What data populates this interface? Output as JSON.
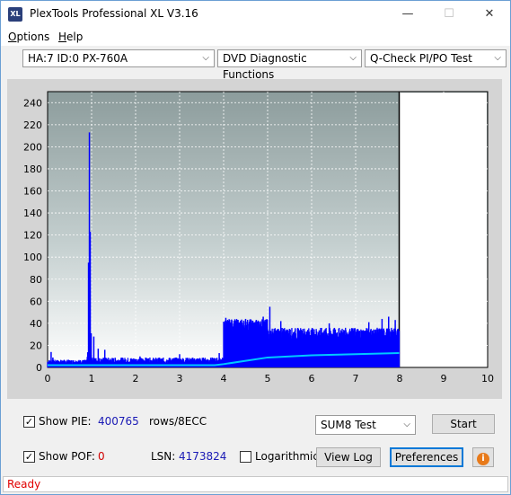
{
  "window": {
    "title": "PlexTools Professional XL V3.16",
    "icon_text": "XL",
    "minimize_glyph": "—",
    "maximize_glyph": "☐",
    "close_glyph": "✕"
  },
  "menu": {
    "items": [
      {
        "label": "Options",
        "underline": "O",
        "rest": "ptions"
      },
      {
        "label": "Help",
        "underline": "H",
        "rest": "elp"
      }
    ]
  },
  "toolbar": {
    "drive": "HA:7 ID:0  PX-760A",
    "function": "DVD Diagnostic Functions",
    "test": "Q-Check PI/PO Test"
  },
  "chart_data": {
    "type": "bar",
    "x_ticks": [
      "0",
      "1",
      "2",
      "3",
      "4",
      "5",
      "6",
      "7",
      "8",
      "9",
      "10"
    ],
    "y_ticks": [
      "0",
      "20",
      "40",
      "60",
      "80",
      "100",
      "120",
      "140",
      "160",
      "180",
      "200",
      "220",
      "240"
    ],
    "xlim": [
      0,
      10
    ],
    "ylim": [
      0,
      250
    ],
    "grid": true,
    "end_marker_x": 7.99,
    "pie_series": {
      "color": "#0000ff",
      "segments": [
        {
          "x_start": 0.0,
          "x_end": 0.9,
          "base": 3,
          "noise": 4,
          "spikes": [
            [
              0.08,
              14
            ],
            [
              0.12,
              9
            ]
          ]
        },
        {
          "x_start": 0.9,
          "x_end": 1.0,
          "base": 6,
          "noise": 8,
          "spikes": [
            [
              0.93,
              95
            ],
            [
              0.95,
              213
            ],
            [
              0.97,
              123
            ],
            [
              0.99,
              31
            ]
          ]
        },
        {
          "x_start": 1.0,
          "x_end": 4.0,
          "base": 3,
          "noise": 6,
          "spikes": [
            [
              1.05,
              28
            ],
            [
              1.15,
              17
            ],
            [
              1.3,
              16
            ],
            [
              2.1,
              10
            ],
            [
              3.0,
              12
            ],
            [
              3.9,
              13
            ]
          ]
        },
        {
          "x_start": 4.0,
          "x_end": 5.0,
          "base": 30,
          "noise": 14,
          "spikes": [
            [
              4.05,
              45
            ],
            [
              4.5,
              44
            ],
            [
              4.9,
              46
            ],
            [
              5.05,
              55
            ]
          ]
        },
        {
          "x_start": 5.0,
          "x_end": 7.99,
          "base": 24,
          "noise": 12,
          "spikes": [
            [
              5.3,
              42
            ],
            [
              6.4,
              40
            ],
            [
              7.3,
              41
            ],
            [
              7.6,
              44
            ],
            [
              7.75,
              46
            ],
            [
              7.9,
              43
            ]
          ]
        }
      ]
    },
    "sum_line": {
      "color": "#00c8ff",
      "points": [
        [
          0,
          2
        ],
        [
          1,
          2
        ],
        [
          2,
          2
        ],
        [
          3,
          2
        ],
        [
          3.8,
          2
        ],
        [
          4.0,
          3
        ],
        [
          4.5,
          6
        ],
        [
          5.0,
          9
        ],
        [
          5.5,
          10
        ],
        [
          6.0,
          11
        ],
        [
          6.5,
          11.5
        ],
        [
          7.0,
          12
        ],
        [
          7.5,
          12.5
        ],
        [
          7.99,
          13
        ]
      ]
    }
  },
  "controls": {
    "show_pie_label": "Show PIE:",
    "show_pie_checked": true,
    "pie_value": "400765",
    "pie_unit": "rows/8ECC",
    "show_pof_label": "Show POF:",
    "show_pof_checked": true,
    "pof_value": "0",
    "lsn_label": "LSN:",
    "lsn_value": "4173824",
    "logarithmic_label": "Logarithmic",
    "logarithmic_checked": false,
    "sum_test": "SUM8 Test",
    "start_label": "Start",
    "view_log_label": "View Log",
    "preferences_label": "Preferences",
    "info_glyph": "i"
  },
  "status": {
    "text": "Ready"
  }
}
